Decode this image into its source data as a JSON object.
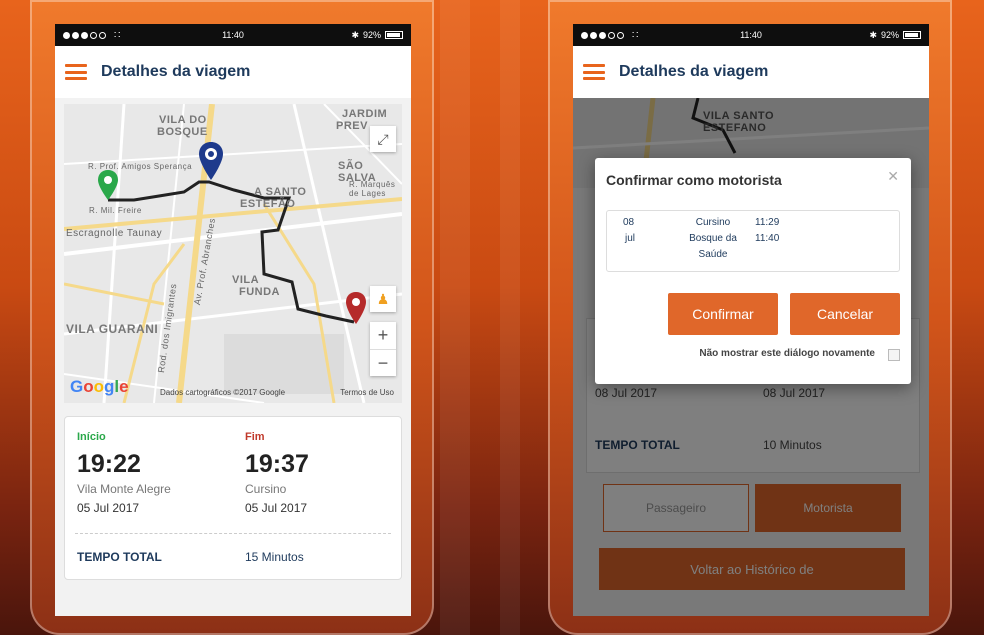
{
  "colors": {
    "accent": "#e8641c",
    "title": "#1e3a5c",
    "start": "#2aa84a",
    "end": "#c0392b",
    "button": "#e0672a"
  },
  "status_bar": {
    "signal_icon": "signal-dots-icon",
    "wifi_icon": "wifi-icon",
    "time": "11:40",
    "bluetooth_icon": "bluetooth-icon",
    "battery": "92%",
    "battery_icon": "battery-icon"
  },
  "header": {
    "menu_icon": "hamburger-icon",
    "title": "Detalhes da viagem"
  },
  "map": {
    "labels": {
      "vila_do": "VILA DO",
      "bosque": "BOSQUE",
      "jardim": "JARDIM",
      "prev": "PREV",
      "sao_salv": "SÃO SALVA",
      "santo": "A SANTO",
      "estefao": "ESTEFÃO",
      "vila": "VILA",
      "funda": "FUNDA",
      "vila_guarani": "VILA GUARANI",
      "escragnolle": "Escragnolle Taunay",
      "imigrantes": "Rod. dos Imigrantes",
      "abranches": "Av. Prof. Abranches",
      "mil": "R. Mil. Freire",
      "amigos": "R. Prof. Amigos Sperança",
      "marques": "R. Marquês de Lages",
      "v_santo": "VILA SANTO",
      "v_estefano": "ESTEFANO"
    },
    "fullscreen_icon": "expand-icon",
    "street_view_icon": "pegman-icon",
    "zoom_in": "+",
    "zoom_out": "−",
    "google": "Google",
    "attribution": "Dados cartográficos ©2017 Google",
    "terms": "Termos de Uso",
    "start_marker_icon": "green-pin-icon",
    "mid_marker_icon": "blue-pin-icon",
    "end_marker_icon": "red-pin-icon"
  },
  "trip": {
    "start_label": "Início",
    "start_time": "19:22",
    "start_place": "Vila Monte Alegre",
    "start_date": "05 Jul 2017",
    "end_label": "Fim",
    "end_time": "19:37",
    "end_place": "Cursino",
    "end_date": "05 Jul 2017",
    "total_label": "TEMPO TOTAL",
    "total_value": "15 Minutos"
  },
  "screen2_background": {
    "date1": "08 Jul 2017",
    "date2": "08 Jul 2017",
    "total_label": "TEMPO TOTAL",
    "total_value": "10 Minutos",
    "passenger_button": "Passageiro",
    "driver_button": "Motorista",
    "back_button": "Voltar ao Histórico de"
  },
  "dialog": {
    "title": "Confirmar como motorista",
    "close_icon": "close-icon",
    "day": "08",
    "month": "jul",
    "place_line1": "Cursino",
    "place_line2": "Bosque da",
    "place_line3": "Saúde",
    "time_start": "11:29",
    "time_end": "11:40",
    "confirm_button": "Confirmar",
    "cancel_button": "Cancelar",
    "dont_show_label": "Não mostrar este diálogo novamente"
  }
}
